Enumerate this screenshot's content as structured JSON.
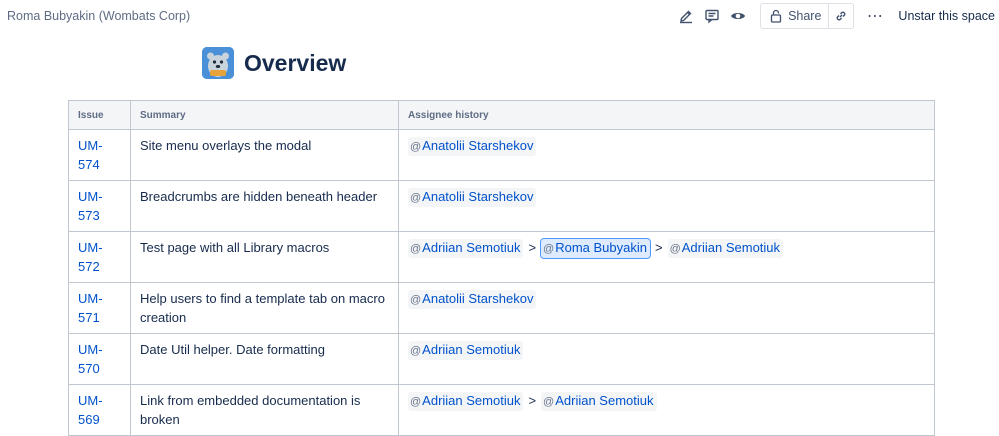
{
  "header": {
    "space_name": "Roma Bubyakin (Wombats Corp)",
    "actions": {
      "edit_icon": "edit-icon",
      "comment_icon": "comment-icon",
      "watch_icon": "eye-icon",
      "share_label": "Share",
      "share_icon": "lock-icon",
      "link_icon": "link-icon",
      "more_label": "⋯",
      "unstar_label": "Unstar this space"
    }
  },
  "page": {
    "title": "Overview",
    "logo_icon": "space-avatar-icon"
  },
  "table": {
    "columns": [
      "Issue",
      "Summary",
      "Assignee history"
    ],
    "rows": [
      {
        "issue": "UM-574",
        "summary": "Site menu overlays the modal",
        "assignees": [
          "Anatolii Starshekov"
        ]
      },
      {
        "issue": "UM-573",
        "summary": "Breadcrumbs are hidden beneath header",
        "assignees": [
          "Anatolii Starshekov"
        ]
      },
      {
        "issue": "UM-572",
        "summary": "Test page with all Library macros",
        "assignees": [
          "Adriian Semotiuk",
          "Roma Bubyakin",
          "Adriian Semotiuk"
        ],
        "selected_index": 1
      },
      {
        "issue": "UM-571",
        "summary": "Help users to find a template tab on macro creation",
        "assignees": [
          "Anatolii Starshekov"
        ]
      },
      {
        "issue": "UM-570",
        "summary": "Date Util helper. Date formatting",
        "assignees": [
          "Adriian Semotiuk"
        ]
      },
      {
        "issue": "UM-569",
        "summary": "Link from embedded documentation is broken",
        "assignees": [
          "Adriian Semotiuk",
          "Adriian Semotiuk"
        ]
      }
    ],
    "separator": ">",
    "mention_prefix": "@"
  },
  "colors": {
    "link": "#0052cc",
    "header_bg": "#f4f5f7",
    "border": "#c1c7d0",
    "text": "#172b4d",
    "selected_mention_bg": "#deebff"
  }
}
